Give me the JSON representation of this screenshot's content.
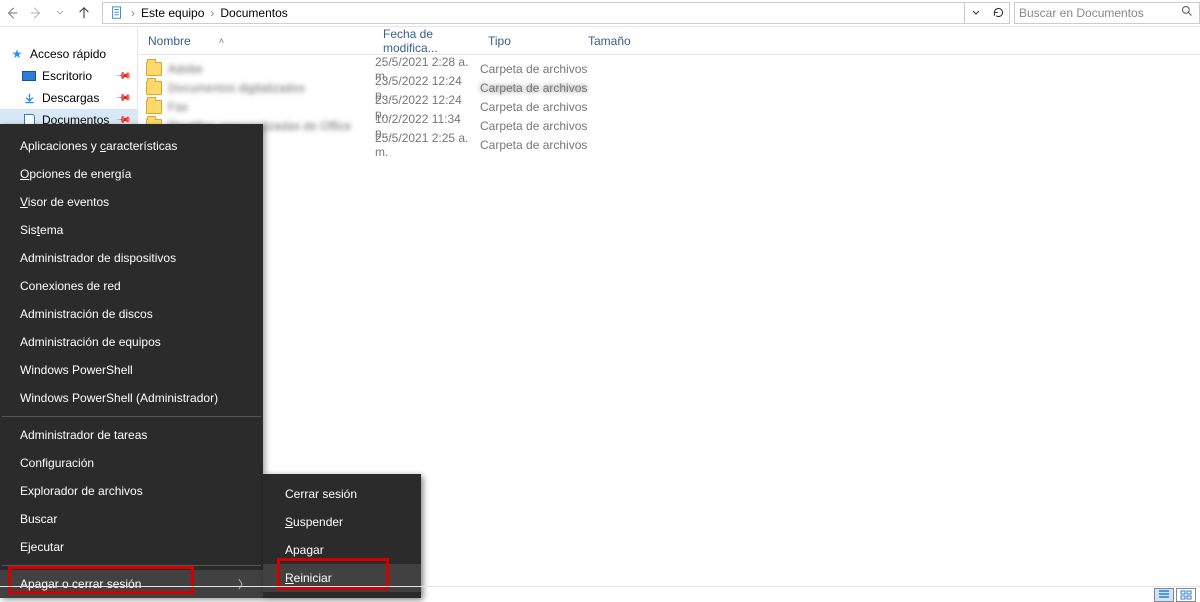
{
  "breadcrumb": {
    "seg1": "Este equipo",
    "seg2": "Documentos"
  },
  "search": {
    "placeholder": "Buscar en Documentos"
  },
  "sidebar": {
    "quick": "Acceso rápido",
    "desktop": "Escritorio",
    "downloads": "Descargas",
    "documents": "Documentos"
  },
  "columns": {
    "name": "Nombre",
    "date": "Fecha de modifica...",
    "type": "Tipo",
    "size": "Tamaño"
  },
  "rows": [
    {
      "name": "Adobe",
      "date": "25/5/2021 2:28 a. m.",
      "type": "Carpeta de archivos"
    },
    {
      "name": "Documentos digitalizados",
      "date": "23/5/2022 12:24 p...",
      "type": "Carpeta de archivos"
    },
    {
      "name": "Fax",
      "date": "23/5/2022 12:24 p...",
      "type": "Carpeta de archivos"
    },
    {
      "name": "Plantillas personalizadas de Office",
      "date": "10/2/2022 11:34 p...",
      "type": "Carpeta de archivos"
    },
    {
      "name": "",
      "date": "25/5/2021 2:25 a. m.",
      "type": "Carpeta de archivos"
    }
  ],
  "winx": {
    "apps": {
      "pre": "Aplicaciones y ",
      "u": "c",
      "post": "aracterísticas"
    },
    "power_opts": {
      "u": "O",
      "post": "pciones de energía"
    },
    "event_viewer": {
      "u": "V",
      "post": "isor de eventos"
    },
    "system": {
      "pre": "Sis",
      "u": "t",
      "post": "ema"
    },
    "devmgr": "Administrador de dispositivos",
    "netconn": "Conexiones de red",
    "diskmgmt": "Administración de discos",
    "compmgmt": "Administración de equipos",
    "powershell": "Windows PowerShell",
    "powershell_admin": "Windows PowerShell (Administrador)",
    "taskmgr": "Administrador de tareas",
    "settings": "Configuración",
    "file_explorer": "Explorador de archivos",
    "search": "Buscar",
    "run": "Ejecutar",
    "shutdown": "Apagar o cerrar sesión"
  },
  "submenu": {
    "signout": "Cerrar sesión",
    "sleep": {
      "u": "S",
      "post": "uspender"
    },
    "shutdown": "Apagar",
    "restart": {
      "u": "R",
      "post": "einiciar"
    }
  }
}
